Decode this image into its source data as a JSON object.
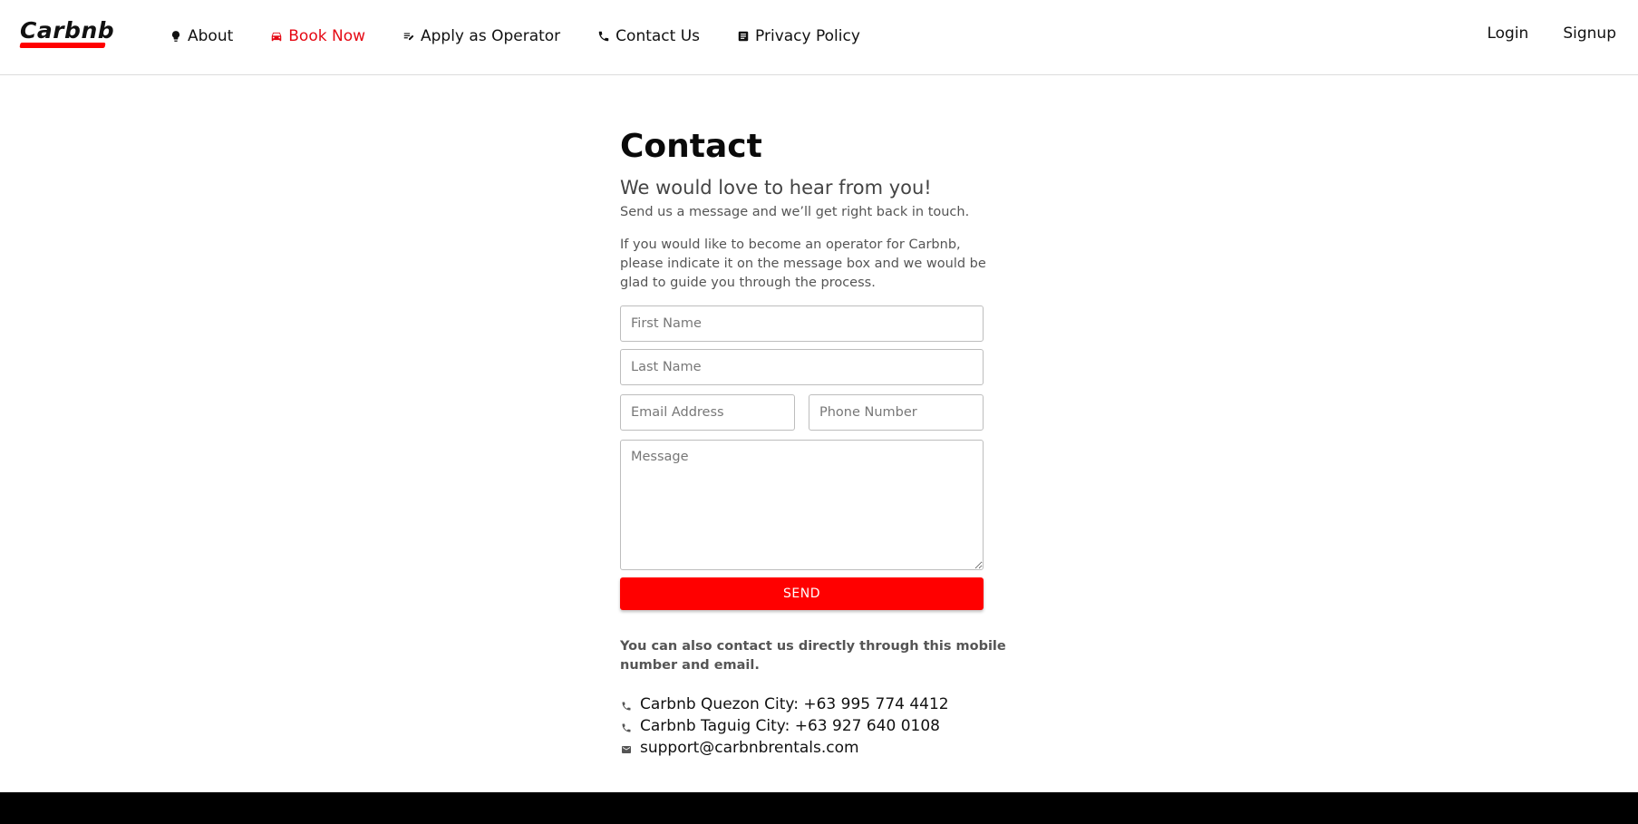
{
  "brand": {
    "name": "Carbnb",
    "accent": "#ff0000",
    "active_nav_color": "#e50914"
  },
  "nav": {
    "items": [
      {
        "label": "About",
        "icon": "lightbulb-icon",
        "active": false
      },
      {
        "label": "Book Now",
        "icon": "car-icon",
        "active": true
      },
      {
        "label": "Apply as Operator",
        "icon": "edit-note-icon",
        "active": false
      },
      {
        "label": "Contact Us",
        "icon": "phone-icon",
        "active": false
      },
      {
        "label": "Privacy Policy",
        "icon": "document-icon",
        "active": false
      }
    ]
  },
  "auth": {
    "login": "Login",
    "signup": "Signup"
  },
  "main": {
    "title": "Contact",
    "subtitle": "We would love to hear from you!",
    "lead": "Send us a message and we’ll get right back in touch.",
    "info": "If you would like to become an operator for Carbnb, please indicate it on the message box and we would be glad to guide you through the process."
  },
  "form": {
    "first_name": {
      "placeholder": "First Name",
      "value": ""
    },
    "last_name": {
      "placeholder": "Last Name",
      "value": ""
    },
    "email": {
      "placeholder": "Email Address",
      "value": ""
    },
    "phone": {
      "placeholder": "Phone Number",
      "value": ""
    },
    "message": {
      "placeholder": "Message",
      "value": ""
    },
    "send_label": "SEND"
  },
  "direct": {
    "text": "You can also contact us directly through this mobile number and email.",
    "lines": [
      {
        "icon": "phone-icon",
        "text": "Carbnb Quezon City: +63 995 774 4412"
      },
      {
        "icon": "phone-icon",
        "text": "Carbnb Taguig City: +63 927 640 0108"
      },
      {
        "icon": "mail-icon",
        "text": "support@carbnbrentals.com"
      }
    ]
  }
}
